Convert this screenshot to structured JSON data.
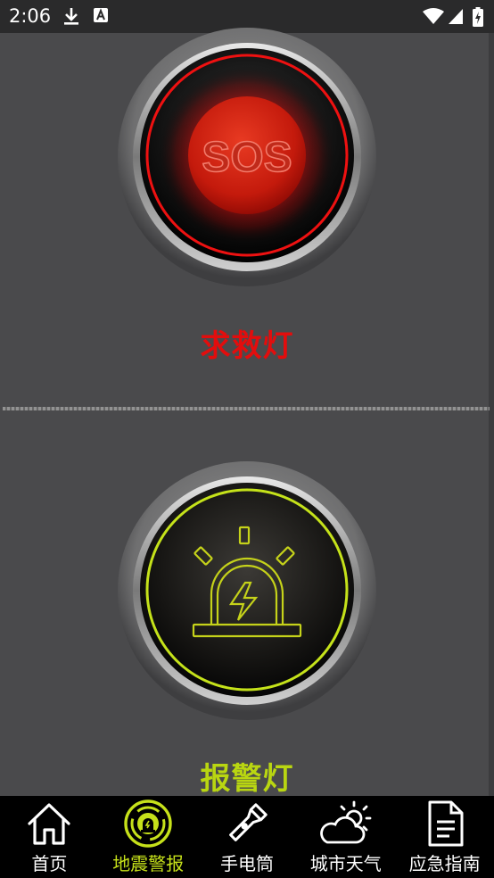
{
  "status_bar": {
    "time": "2:06",
    "left_icons": [
      "download-icon",
      "a-box-icon"
    ],
    "right_icons": [
      "wifi-icon",
      "cell-signal-icon",
      "battery-charging-icon"
    ]
  },
  "sos": {
    "button_text": "SOS",
    "label": "求救灯",
    "color": "#e30d0d"
  },
  "alarm": {
    "icon": "siren-lightning-icon",
    "label": "报警灯",
    "color": "#b9d611"
  },
  "bottom_nav": {
    "items": [
      {
        "label": "首页",
        "icon": "home-icon",
        "active": false
      },
      {
        "label": "地震警报",
        "icon": "earthquake-alarm-icon",
        "active": true
      },
      {
        "label": "手电筒",
        "icon": "flashlight-icon",
        "active": false
      },
      {
        "label": "城市天气",
        "icon": "weather-cloud-sun-icon",
        "active": false
      },
      {
        "label": "应急指南",
        "icon": "document-icon",
        "active": false
      }
    ],
    "active_color": "#c6e11a"
  }
}
